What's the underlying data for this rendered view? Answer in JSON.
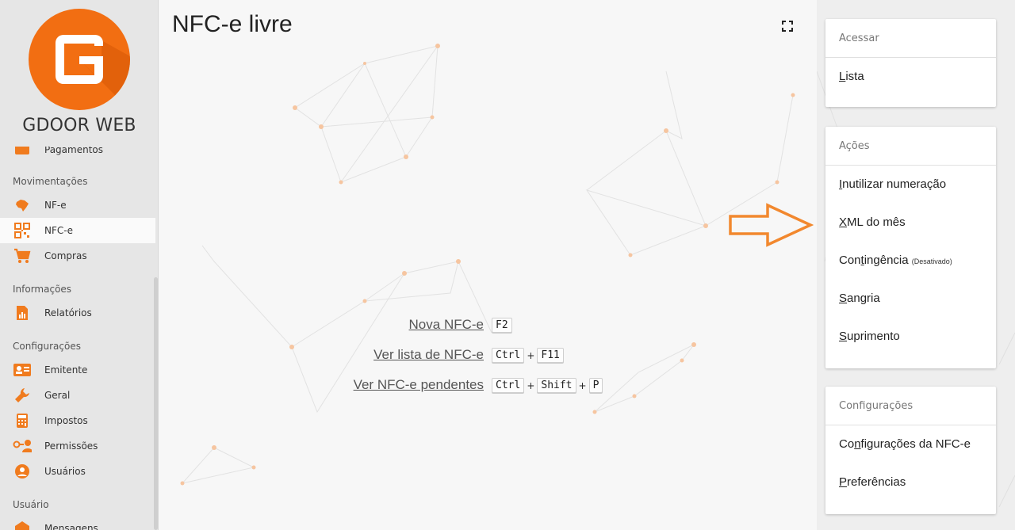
{
  "brand": {
    "name": "GDOOR WEB",
    "accent": "#f26e12"
  },
  "sidebar": {
    "partial_item": "Pagamentos",
    "sections": [
      {
        "title": "Movimentações",
        "items": [
          {
            "label": "NF-e",
            "icon": "brazil-map-icon"
          },
          {
            "label": "NFC-e",
            "icon": "qr-code-icon",
            "active": true
          },
          {
            "label": "Compras",
            "icon": "shopping-cart-icon"
          }
        ]
      },
      {
        "title": "Informações",
        "items": [
          {
            "label": "Relatórios",
            "icon": "report-icon"
          }
        ]
      },
      {
        "title": "Configurações",
        "items": [
          {
            "label": "Emitente",
            "icon": "id-card-icon"
          },
          {
            "label": "Geral",
            "icon": "wrench-icon"
          },
          {
            "label": "Impostos",
            "icon": "calculator-icon"
          },
          {
            "label": "Permissões",
            "icon": "key-user-icon"
          },
          {
            "label": "Usuários",
            "icon": "user-icon"
          }
        ]
      },
      {
        "title": "Usuário",
        "items": [
          {
            "label": "Mensagens",
            "icon": "message-icon"
          }
        ]
      }
    ]
  },
  "main": {
    "title": "NFC-e livre",
    "shortcuts": [
      {
        "label": "Nova NFC-e",
        "keys": [
          "F2"
        ]
      },
      {
        "label": "Ver lista de NFC-e",
        "keys": [
          "Ctrl",
          "F11"
        ]
      },
      {
        "label": "Ver NFC-e pendentes",
        "keys": [
          "Ctrl",
          "Shift",
          "P"
        ]
      }
    ],
    "collapse_glyph": "»"
  },
  "panel": {
    "acessar": {
      "title": "Acessar",
      "items": [
        {
          "first": "L",
          "rest": "ista"
        }
      ]
    },
    "acoes": {
      "title": "Ações",
      "items": [
        {
          "first": "I",
          "rest": "nutilizar numeração"
        },
        {
          "first": "X",
          "rest": "ML do mês"
        },
        {
          "first": "Con",
          "u": "t",
          "rest": "ingência",
          "note": "(Desativado)"
        },
        {
          "first": "S",
          "rest": "angria"
        },
        {
          "first": "S",
          "rest": "uprimento"
        }
      ]
    },
    "config": {
      "title": "Configurações",
      "items": [
        {
          "first": "Co",
          "u": "n",
          "rest": "figurações da NFC-e"
        },
        {
          "first": "P",
          "rest": "referências"
        }
      ]
    }
  }
}
